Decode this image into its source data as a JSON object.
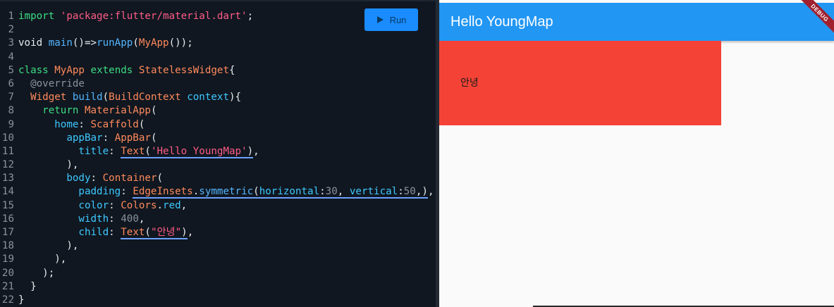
{
  "editor": {
    "run_label": "Run",
    "lines": [
      {
        "n": "1",
        "tokens": [
          [
            "kw",
            "import"
          ],
          [
            "",
            " "
          ],
          [
            "str",
            "'package:flutter/material.dart'"
          ],
          [
            "",
            ";"
          ]
        ]
      },
      {
        "n": "2",
        "tokens": []
      },
      {
        "n": "3",
        "tokens": [
          [
            "",
            "void "
          ],
          [
            "fn",
            "main"
          ],
          [
            "",
            "()=>"
          ],
          [
            "fn",
            "runApp"
          ],
          [
            "",
            "("
          ],
          [
            "ty",
            "MyApp"
          ],
          [
            "",
            "());"
          ]
        ]
      },
      {
        "n": "4",
        "tokens": []
      },
      {
        "n": "5",
        "tokens": [
          [
            "kw",
            "class"
          ],
          [
            "",
            " "
          ],
          [
            "ty",
            "MyApp"
          ],
          [
            "",
            " "
          ],
          [
            "kw",
            "extends"
          ],
          [
            "",
            " "
          ],
          [
            "ty",
            "StatelessWidget"
          ],
          [
            "",
            "{"
          ]
        ]
      },
      {
        "n": "6",
        "tokens": [
          [
            "",
            "  "
          ],
          [
            "ann",
            "@override"
          ]
        ]
      },
      {
        "n": "7",
        "tokens": [
          [
            "",
            "  "
          ],
          [
            "ty",
            "Widget"
          ],
          [
            "",
            " "
          ],
          [
            "fn",
            "build"
          ],
          [
            "",
            "("
          ],
          [
            "ty",
            "BuildContext"
          ],
          [
            "",
            " "
          ],
          [
            "prop",
            "context"
          ],
          [
            "",
            "){"
          ]
        ]
      },
      {
        "n": "8",
        "tokens": [
          [
            "",
            "    "
          ],
          [
            "kw",
            "return"
          ],
          [
            "",
            " "
          ],
          [
            "ty",
            "MaterialApp"
          ],
          [
            "",
            "("
          ]
        ]
      },
      {
        "n": "9",
        "tokens": [
          [
            "",
            "      "
          ],
          [
            "prop",
            "home"
          ],
          [
            "",
            ": "
          ],
          [
            "ty",
            "Scaffold"
          ],
          [
            "",
            "("
          ]
        ]
      },
      {
        "n": "10",
        "tokens": [
          [
            "",
            "        "
          ],
          [
            "prop",
            "appBar"
          ],
          [
            "",
            ": "
          ],
          [
            "ty",
            "AppBar"
          ],
          [
            "",
            "("
          ]
        ]
      },
      {
        "n": "11",
        "tokens": [
          [
            "",
            "          "
          ],
          [
            "prop",
            "title"
          ],
          [
            "",
            ": "
          ],
          [
            "ty wave",
            "Text"
          ],
          [
            "wave",
            "("
          ],
          [
            "str wave",
            "'Hello YoungMap'"
          ],
          [
            "wave",
            ")"
          ],
          [
            "",
            ","
          ]
        ]
      },
      {
        "n": "12",
        "tokens": [
          [
            "",
            "        ),"
          ]
        ]
      },
      {
        "n": "13",
        "tokens": [
          [
            "",
            "        "
          ],
          [
            "prop",
            "body"
          ],
          [
            "",
            ": "
          ],
          [
            "ty",
            "Container"
          ],
          [
            "",
            "("
          ]
        ]
      },
      {
        "n": "14",
        "tokens": [
          [
            "",
            "          "
          ],
          [
            "prop",
            "padding"
          ],
          [
            "",
            ": "
          ],
          [
            "ty wave",
            "EdgeInsets"
          ],
          [
            "wave",
            "."
          ],
          [
            "fn wave",
            "symmetric"
          ],
          [
            "wave",
            "("
          ],
          [
            "prop wave",
            "horizontal"
          ],
          [
            "wave",
            ":"
          ],
          [
            "num wave",
            "30"
          ],
          [
            "wave",
            ", "
          ],
          [
            "prop wave",
            "vertical"
          ],
          [
            "wave",
            ":"
          ],
          [
            "num wave",
            "50"
          ],
          [
            "wave",
            ",)"
          ],
          [
            "",
            ","
          ]
        ]
      },
      {
        "n": "15",
        "tokens": [
          [
            "",
            "          "
          ],
          [
            "prop",
            "color"
          ],
          [
            "",
            ": "
          ],
          [
            "ty",
            "Colors"
          ],
          [
            "",
            "."
          ],
          [
            "prop",
            "red"
          ],
          [
            "",
            ","
          ]
        ]
      },
      {
        "n": "16",
        "tokens": [
          [
            "",
            "          "
          ],
          [
            "prop",
            "width"
          ],
          [
            "",
            ": "
          ],
          [
            "num",
            "400"
          ],
          [
            "",
            ","
          ]
        ]
      },
      {
        "n": "17",
        "tokens": [
          [
            "",
            "          "
          ],
          [
            "prop",
            "child"
          ],
          [
            "",
            ": "
          ],
          [
            "ty wave",
            "Text"
          ],
          [
            "wave",
            "("
          ],
          [
            "str wave",
            "\"안녕\""
          ],
          [
            "wave",
            ")"
          ],
          [
            "",
            ","
          ]
        ]
      },
      {
        "n": "18",
        "tokens": [
          [
            "",
            "        ),"
          ]
        ]
      },
      {
        "n": "19",
        "tokens": [
          [
            "",
            "      ),"
          ]
        ]
      },
      {
        "n": "20",
        "tokens": [
          [
            "",
            "    );"
          ]
        ]
      },
      {
        "n": "21",
        "tokens": [
          [
            "",
            "  }"
          ]
        ]
      },
      {
        "n": "22",
        "tokens": [
          [
            "",
            "}"
          ]
        ]
      }
    ]
  },
  "preview": {
    "appbar_title": "Hello YoungMap",
    "appbar_color": "#2196f3",
    "container_text": "안녕",
    "container_color": "#f44336",
    "debug_label": "DEBUG"
  }
}
